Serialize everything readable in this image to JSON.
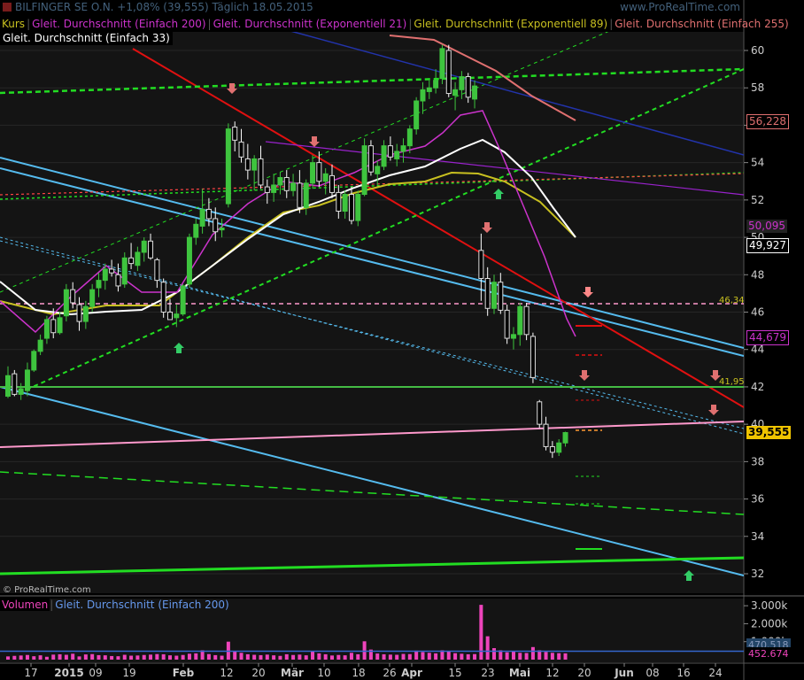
{
  "header": {
    "line1": "BILFINGER SE O.N.    +1,08% (39,555)  Täglich  18.05.2015",
    "kurs": "Kurs",
    "ma200": "Gleit. Durchschnitt (Einfach 200)",
    "ema21": "Gleit. Durchschnitt (Exponentiell 21)",
    "ema89": "Gleit. Durchschnitt (Exponentiell 89)",
    "ma255": "Gleit. Durchschnitt (Einfach 255)",
    "ma33": "Gleit. Durchschnitt (Einfach 33)",
    "watermark": "www.ProRealTime.com"
  },
  "copyright": "© ProRealTime.com",
  "volume_header": {
    "volumen": "Volumen",
    "ma200": "Gleit. Durchschnitt (Einfach 200)"
  },
  "price_axis": {
    "ticks": [
      "60",
      "58",
      "56",
      "54",
      "52",
      "50",
      "48",
      "46",
      "44",
      "42",
      "40",
      "38",
      "36",
      "34",
      "32"
    ],
    "boxes": {
      "ma255": "56,228",
      "ma200": "50,095",
      "last": "49,927",
      "ema21": "44,679",
      "close": "39,555"
    }
  },
  "volume_axis": {
    "ticks": [
      "3.000k",
      "2.000k",
      "1.000k"
    ],
    "boxes": {
      "v1": "470.518",
      "v2": "452.674"
    }
  },
  "level_labels": {
    "l1": "46,34",
    "l2": "41,95"
  },
  "time_axis": {
    "labels": [
      "17",
      "2015",
      "09",
      "19",
      "Feb",
      "12",
      "20",
      "Mär",
      "10",
      "18",
      "26",
      "Apr",
      "15",
      "23",
      "Mai",
      "12",
      "20",
      "Jun",
      "08",
      "16",
      "24"
    ]
  },
  "colors": {
    "up": "#3ec43e",
    "down": "#ffffff",
    "ma200": "#cc33cc",
    "ema21": "#cc33cc",
    "ema89": "#c8c020",
    "ma255": "#e07070",
    "ma33": "#ffffff",
    "trend_red": "#e01010",
    "trend_blue": "#55bbee",
    "trend_green": "#22dd22",
    "pink_level": "#ff99cc",
    "green_level": "#44bb44",
    "navy": "#2233aa",
    "volume": "#ee44bb"
  },
  "chart_data": {
    "type": "candlestick",
    "title": "BILFINGER SE O.N.",
    "instrument": "BILFINGER SE O.N.",
    "change": "+1,08%",
    "close": 39.555,
    "interval": "Täglich",
    "date": "18.05.2015",
    "y_range": [
      31.5,
      61.8
    ],
    "x": [
      "17",
      "2015",
      "09",
      "19",
      "Feb",
      "12",
      "20",
      "Mär",
      "10",
      "18",
      "26",
      "Apr",
      "15",
      "23",
      "Mai",
      "12",
      "20",
      "Jun",
      "08",
      "16",
      "24"
    ],
    "candles": [
      [
        41.5,
        43.1,
        41.4,
        42.6
      ],
      [
        42.7,
        42.9,
        41.5,
        41.6
      ],
      [
        41.6,
        42.2,
        41.3,
        41.9
      ],
      [
        41.8,
        43.3,
        41.5,
        42.9
      ],
      [
        42.9,
        44.0,
        42.8,
        43.9
      ],
      [
        43.9,
        44.8,
        43.7,
        44.5
      ],
      [
        44.6,
        45.8,
        44.3,
        45.6
      ],
      [
        45.6,
        46.2,
        44.6,
        44.9
      ],
      [
        44.9,
        46.0,
        44.8,
        45.7
      ],
      [
        45.8,
        47.5,
        45.5,
        47.2
      ],
      [
        47.2,
        47.6,
        46.2,
        46.5
      ],
      [
        46.4,
        46.8,
        45.0,
        45.5
      ],
      [
        45.5,
        46.6,
        45.1,
        46.3
      ],
      [
        46.3,
        47.5,
        46.0,
        47.2
      ],
      [
        47.3,
        48.1,
        46.8,
        47.7
      ],
      [
        47.7,
        48.6,
        47.2,
        48.3
      ],
      [
        48.3,
        48.8,
        47.9,
        48.1
      ],
      [
        48.0,
        48.6,
        47.1,
        47.4
      ],
      [
        47.5,
        49.2,
        47.3,
        48.9
      ],
      [
        48.9,
        49.7,
        48.3,
        48.6
      ],
      [
        48.5,
        49.5,
        48.2,
        49.2
      ],
      [
        49.2,
        50.0,
        48.7,
        49.8
      ],
      [
        49.8,
        50.2,
        48.8,
        48.9
      ],
      [
        48.8,
        48.9,
        47.3,
        47.7
      ],
      [
        47.6,
        47.8,
        45.7,
        46.0
      ],
      [
        46.0,
        46.7,
        45.6,
        45.6
      ],
      [
        45.7,
        46.4,
        45.2,
        45.9
      ],
      [
        45.9,
        47.5,
        45.8,
        47.4
      ],
      [
        47.5,
        50.2,
        47.3,
        50.0
      ],
      [
        50.0,
        51.0,
        49.6,
        50.7
      ],
      [
        50.6,
        52.6,
        50.2,
        51.5
      ],
      [
        51.5,
        52.1,
        50.6,
        51.0
      ],
      [
        51.0,
        51.6,
        49.8,
        50.3
      ],
      [
        50.4,
        51.0,
        50.0,
        50.5
      ],
      [
        51.8,
        56.1,
        51.6,
        55.8
      ],
      [
        55.9,
        56.2,
        54.6,
        55.2
      ],
      [
        55.1,
        55.8,
        54.0,
        54.3
      ],
      [
        54.2,
        55.0,
        53.1,
        53.6
      ],
      [
        53.6,
        54.4,
        52.5,
        54.2
      ],
      [
        54.2,
        54.9,
        52.6,
        52.8
      ],
      [
        52.7,
        53.1,
        51.8,
        52.4
      ],
      [
        52.4,
        53.4,
        51.9,
        52.8
      ],
      [
        52.8,
        53.5,
        52.3,
        53.2
      ],
      [
        53.2,
        53.6,
        52.1,
        52.5
      ],
      [
        52.5,
        53.4,
        52.2,
        52.9
      ],
      [
        52.9,
        53.6,
        51.3,
        51.6
      ],
      [
        51.6,
        53.1,
        51.2,
        52.9
      ],
      [
        52.9,
        54.4,
        52.6,
        54.0
      ],
      [
        54.0,
        54.6,
        52.7,
        53.0
      ],
      [
        53.0,
        53.7,
        52.3,
        53.4
      ],
      [
        53.3,
        53.9,
        52.1,
        52.4
      ],
      [
        52.4,
        52.8,
        51.0,
        51.4
      ],
      [
        51.4,
        52.5,
        51.0,
        52.3
      ],
      [
        52.3,
        52.7,
        50.7,
        50.9
      ],
      [
        50.9,
        52.5,
        50.6,
        52.3
      ],
      [
        52.3,
        55.3,
        52.2,
        54.9
      ],
      [
        54.9,
        55.2,
        53.3,
        53.5
      ],
      [
        53.4,
        54.1,
        52.8,
        53.8
      ],
      [
        53.8,
        55.2,
        53.6,
        54.9
      ],
      [
        54.9,
        55.4,
        54.1,
        54.3
      ],
      [
        54.2,
        55.0,
        53.8,
        54.6
      ],
      [
        54.6,
        55.3,
        54.0,
        54.9
      ],
      [
        54.9,
        56.0,
        54.5,
        55.8
      ],
      [
        55.8,
        57.5,
        55.5,
        57.3
      ],
      [
        57.3,
        58.3,
        56.6,
        57.9
      ],
      [
        57.8,
        58.4,
        57.4,
        58.0
      ],
      [
        58.0,
        59.0,
        57.7,
        58.4
      ],
      [
        58.5,
        60.3,
        58.2,
        60.1
      ],
      [
        60.0,
        60.3,
        57.5,
        57.7
      ],
      [
        57.6,
        58.3,
        56.8,
        57.9
      ],
      [
        57.9,
        58.9,
        57.4,
        58.6
      ],
      [
        58.6,
        58.8,
        57.2,
        57.5
      ],
      [
        57.4,
        58.4,
        56.9,
        58.1
      ],
      [
        49.3,
        50.2,
        46.6,
        47.8
      ],
      [
        47.8,
        48.4,
        45.8,
        46.2
      ],
      [
        46.2,
        48.0,
        45.9,
        47.6
      ],
      [
        47.6,
        48.1,
        45.9,
        46.1
      ],
      [
        46.1,
        46.4,
        44.3,
        44.6
      ],
      [
        44.6,
        45.2,
        44.0,
        44.8
      ],
      [
        44.8,
        46.5,
        44.2,
        46.3
      ],
      [
        46.3,
        46.5,
        44.5,
        44.8
      ],
      [
        44.7,
        44.9,
        42.2,
        42.5
      ],
      [
        41.2,
        41.3,
        39.8,
        40.0
      ],
      [
        40.0,
        40.4,
        38.6,
        38.8
      ],
      [
        38.8,
        39.1,
        38.2,
        38.5
      ],
      [
        38.5,
        39.2,
        38.3,
        39.0
      ],
      [
        39.0,
        39.6,
        38.8,
        39.555
      ]
    ],
    "volume": [
      180,
      210,
      230,
      260,
      190,
      240,
      160,
      280,
      300,
      270,
      330,
      180,
      290,
      310,
      250,
      240,
      200,
      190,
      270,
      220,
      230,
      260,
      280,
      310,
      300,
      240,
      220,
      260,
      330,
      350,
      520,
      310,
      250,
      220,
      1000,
      460,
      380,
      300,
      270,
      250,
      280,
      240,
      210,
      300,
      260,
      280,
      240,
      480,
      350,
      300,
      230,
      260,
      240,
      380,
      300,
      1020,
      560,
      340,
      300,
      280,
      270,
      320,
      310,
      500,
      420,
      380,
      350,
      520,
      460,
      360,
      330,
      300,
      310,
      3050,
      1300,
      640,
      520,
      410,
      460,
      380,
      370,
      700,
      520,
      430,
      380,
      360,
      350
    ],
    "volume_ylim": [
      0,
      3400
    ],
    "levels": [
      46.34,
      41.95
    ],
    "indicators": [
      "Gleit. Durchschnitt (Einfach 200)",
      "Gleit. Durchschnitt (Exponentiell 21)",
      "Gleit. Durchschnitt (Exponentiell 89)",
      "Gleit. Durchschnitt (Einfach 255)",
      "Gleit. Durchschnitt (Einfach 33)"
    ]
  }
}
